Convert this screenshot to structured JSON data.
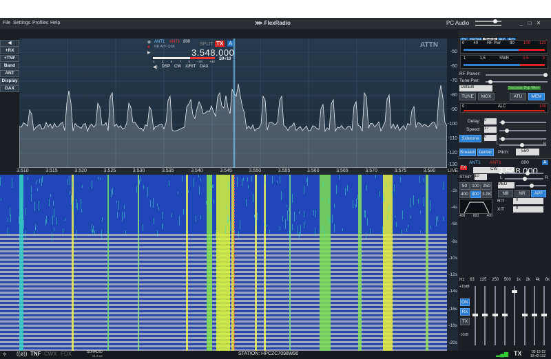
{
  "menu": [
    "File",
    "Settings",
    "Profiles",
    "Help"
  ],
  "brand": "FlexRadio",
  "audio": "PC Audio",
  "left_buttons": [
    "+RX",
    "+TNF",
    "Band",
    "ANT",
    "Display",
    "DAX"
  ],
  "attn": "ATTN",
  "db_ticks": [
    "-50",
    "-60",
    "-70",
    "-80",
    "-90",
    "-100",
    "-110",
    "-120",
    "-130"
  ],
  "slice": {
    "ant1": "ANT1",
    "ant2": "ANT1",
    "bw": "800",
    "sub": "NR APF QSK",
    "split": "SPLIT",
    "tx": "TX",
    "letter": "A",
    "freq": "3.548.000",
    "smeter": "S9+10",
    "scale": [
      "1",
      "3",
      "5",
      "7",
      "9",
      "+20",
      "+40"
    ],
    "tabs": [
      "DSP",
      "CW",
      "X/RIT",
      "DAX"
    ]
  },
  "freq_ticks": [
    "3.510",
    "3.515",
    "3.520",
    "3.525",
    "3.530",
    "3.535",
    "3.540",
    "3.545",
    "3.550",
    "3.555",
    "3.560",
    "3.565",
    "3.570",
    "3.575",
    "3.580"
  ],
  "live": "LIVE",
  "time_ticks": [
    "-2s",
    "-4s",
    "-6s",
    "-8s",
    "-10s",
    "-12s",
    "-14s",
    "-16s",
    "-18s",
    "-20s"
  ],
  "right": {
    "tabs": [
      "TX",
      "P/CW",
      "PHNE",
      "RX",
      "EQ"
    ],
    "rfpwr": {
      "label": "RF Pwr",
      "ticks": [
        "0",
        "40",
        "80",
        "100",
        "120"
      ]
    },
    "swr": {
      "label": "SWR",
      "ticks": [
        "1",
        "1.5",
        "2.5",
        "3"
      ]
    },
    "rf_power": "RF Power:",
    "tune_pwr": "Tune Pwr:",
    "profile": "Default",
    "atu_status": "Success Byp Mem",
    "buttons": [
      "TUNE",
      "MOX",
      "ATU",
      "MEM"
    ],
    "alc": {
      "label": "ALC",
      "ticks": [
        "0",
        "100"
      ]
    },
    "delay": "Delay:",
    "delay_v": "0",
    "speed": "Speed:",
    "speed_v": "17",
    "sidetone": "Sidetone",
    "sidetone_v": "0",
    "lr": [
      "L",
      "R"
    ],
    "breakin": "Breakin",
    "iambic": "Iambic",
    "pitch": "Pitch:",
    "pitch_v": "550",
    "rx": {
      "ant1": "ANT1",
      "ant2": "ANT1",
      "bw": "800",
      "letter": "A",
      "freq": "3.548.000",
      "mode": "CW",
      "step": "STEP:",
      "step_v": "10",
      "lr": [
        "L",
        "R"
      ],
      "filters": [
        "50",
        "100",
        "250",
        "400",
        "800",
        "3.0K"
      ],
      "agc": "MED",
      "dsp": [
        "NB",
        "NR",
        "APF"
      ],
      "rit": "RIT",
      "xit": "XIT",
      "rit_v": "0",
      "xit_v": "0",
      "filt_ticks": [
        "400",
        "800",
        "400"
      ]
    },
    "eq_bands": [
      "Hz",
      "63",
      "125",
      "250",
      "500",
      "1k",
      "2k",
      "4k",
      "8k"
    ],
    "eq_top": "+10dB",
    "eq_bot": "-10dB",
    "eq_btns": [
      "ON",
      "RX",
      "TX"
    ]
  },
  "status": {
    "tnf": "TNF",
    "cwx": "CWX",
    "fdx": "FDX",
    "sdr": "SDRADIO",
    "ver": "v1.3.12",
    "station": "STATION: HPCZC7098W90",
    "tx": "TX",
    "date": "03-15-22",
    "time": "19:42:13Z"
  }
}
